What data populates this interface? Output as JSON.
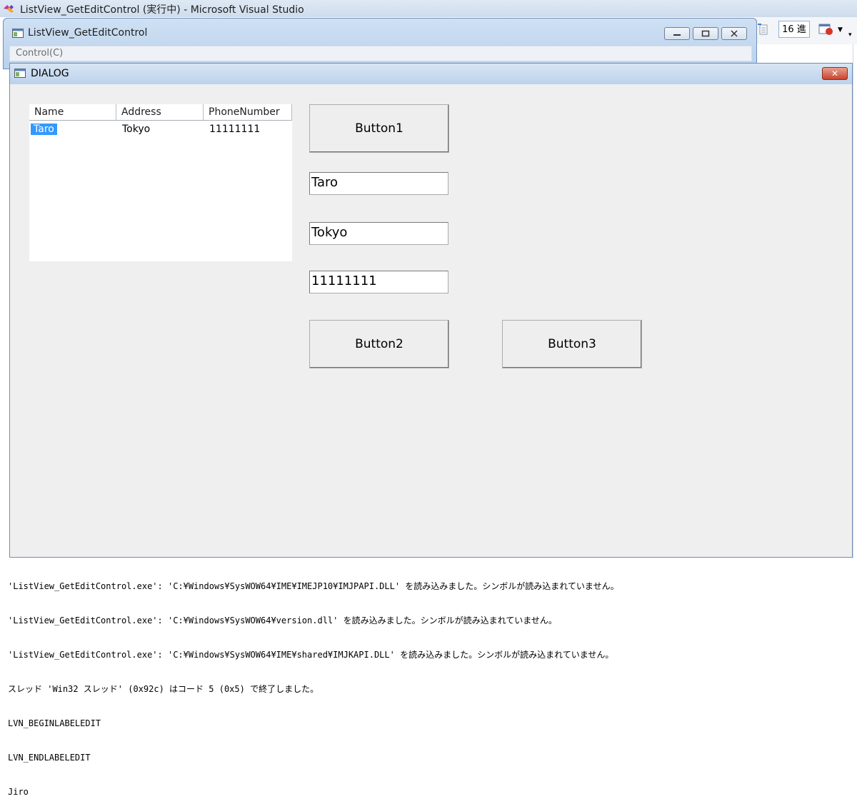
{
  "vs": {
    "title": "ListView_GetEditControl (実行中) - Microsoft Visual Studio",
    "toolbar_hex_label": "16 進"
  },
  "app": {
    "title": "ListView_GetEditControl",
    "menu": [
      "Control(C)"
    ]
  },
  "dialog": {
    "title": "DIALOG",
    "listview": {
      "columns": [
        "Name",
        "Address",
        "PhoneNumber"
      ],
      "rows": [
        {
          "name": "Taro",
          "address": "Tokyo",
          "phone": "11111111",
          "selected": true
        }
      ]
    },
    "buttons": {
      "button1": "Button1",
      "button2": "Button2",
      "button3": "Button3"
    },
    "edits": {
      "name": "Taro",
      "address": "Tokyo",
      "phone": "11111111"
    }
  },
  "output": {
    "lines": [
      "'ListView_GetEditControl.exe': 'C:¥Windows¥SysWOW64¥IME¥IMEJP10¥IMJPAPI.DLL' を読み込みました。シンボルが読み込まれていません。",
      "'ListView_GetEditControl.exe': 'C:¥Windows¥SysWOW64¥version.dll' を読み込みました。シンボルが読み込まれていません。",
      "'ListView_GetEditControl.exe': 'C:¥Windows¥SysWOW64¥IME¥shared¥IMJKAPI.DLL' を読み込みました。シンボルが読み込まれていません。",
      "スレッド 'Win32 スレッド' (0x92c) はコード 5 (0x5) で終了しました。",
      "LVN_BEGINLABELEDIT",
      "LVN_ENDLABELEDIT",
      "Jiro"
    ]
  },
  "colors": {
    "selection": "#3399ff",
    "dialog_bg": "#efefef",
    "titlebar": "#bcd2eb",
    "close_red": "#c8442d"
  }
}
